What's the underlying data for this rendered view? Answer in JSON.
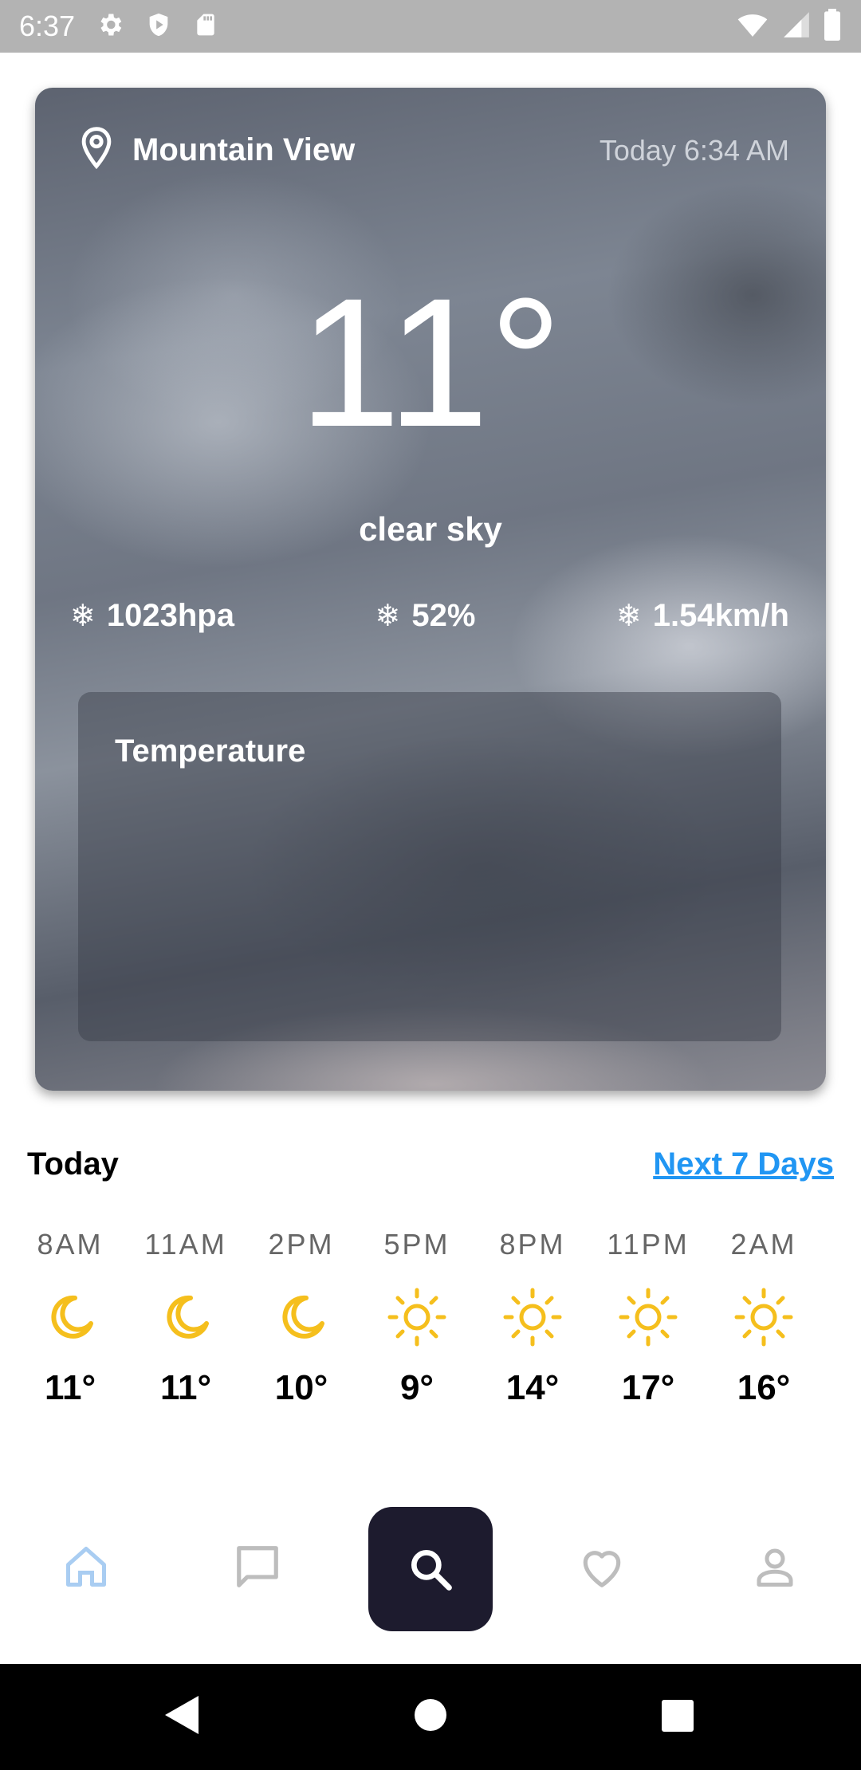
{
  "status_bar": {
    "time": "6:37",
    "left_icons": [
      "gear-icon",
      "shield-icon",
      "sd-card-icon"
    ],
    "right_icons": [
      "wifi-icon",
      "signal-icon",
      "battery-icon"
    ]
  },
  "weather": {
    "location": "Mountain View",
    "updated": "Today 6:34 AM",
    "temperature": "11°",
    "condition": "clear sky",
    "stats": [
      {
        "icon": "snowflake-icon",
        "value": "1023hpa"
      },
      {
        "icon": "snowflake-icon",
        "value": "52%"
      },
      {
        "icon": "snowflake-icon",
        "value": "1.54km/h"
      }
    ],
    "panel_title": "Temperature"
  },
  "today": {
    "label": "Today",
    "next_link": "Next 7 Days",
    "hours": [
      {
        "time": "8AM",
        "icon": "moon-icon",
        "temp": "11°"
      },
      {
        "time": "11AM",
        "icon": "moon-icon",
        "temp": "11°"
      },
      {
        "time": "2PM",
        "icon": "moon-icon",
        "temp": "10°"
      },
      {
        "time": "5PM",
        "icon": "sun-icon",
        "temp": "9°"
      },
      {
        "time": "8PM",
        "icon": "sun-icon",
        "temp": "14°"
      },
      {
        "time": "11PM",
        "icon": "sun-icon",
        "temp": "17°"
      },
      {
        "time": "2AM",
        "icon": "sun-icon",
        "temp": "16°"
      }
    ]
  },
  "bottom_nav": {
    "items": [
      "home-icon",
      "chat-icon",
      "search-icon",
      "heart-icon",
      "person-icon"
    ],
    "active": "home-icon"
  },
  "colors": {
    "accent_blue": "#2196f3",
    "icon_yellow": "#f5bf1d",
    "fab_dark": "#1d1b2e",
    "nav_active": "#a9cdf2",
    "nav_inactive": "#bdbdbd"
  }
}
